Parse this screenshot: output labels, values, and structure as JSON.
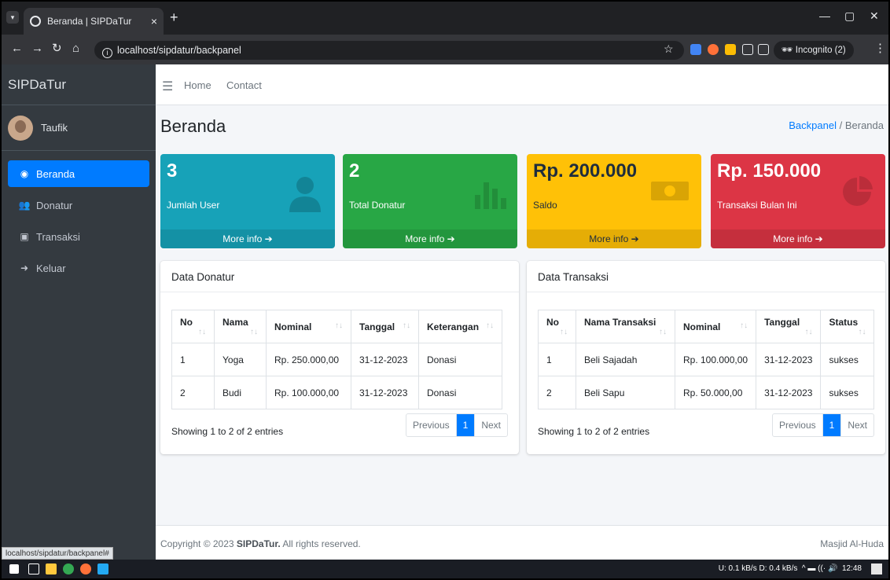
{
  "browser": {
    "tab_title": "Beranda | SIPDaTur",
    "tab_close": "×",
    "new_tab": "+",
    "url": "localhost/sipdatur/backpanel",
    "incognito": "Incognito (2)",
    "status_url": "localhost/sipdatur/backpanel#"
  },
  "sidebar": {
    "brand": "SIPDaTur",
    "user_name": "Taufik",
    "items": [
      {
        "label": "Beranda",
        "icon": "dashboard-icon"
      },
      {
        "label": "Donatur",
        "icon": "users-icon"
      },
      {
        "label": "Transaksi",
        "icon": "money-icon"
      },
      {
        "label": "Keluar",
        "icon": "sign-out-icon"
      }
    ]
  },
  "topnav": {
    "home": "Home",
    "contact": "Contact"
  },
  "page": {
    "title": "Beranda",
    "breadcrumb_link": "Backpanel",
    "breadcrumb_sep": "/",
    "breadcrumb_current": "Beranda"
  },
  "stats": [
    {
      "value": "3",
      "label": "Jumlah User",
      "more": "More info ➔",
      "color": "#17a2b8"
    },
    {
      "value": "2",
      "label": "Total Donatur",
      "more": "More info ➔",
      "color": "#28a745"
    },
    {
      "value": "Rp. 200.000",
      "label": "Saldo",
      "more": "More info ➔",
      "color": "#ffc107"
    },
    {
      "value": "Rp. 150.000",
      "label": "Transaksi Bulan Ini",
      "more": "More info ➔",
      "color": "#dc3545"
    }
  ],
  "donatur_table": {
    "title": "Data Donatur",
    "headers": [
      "No",
      "Nama",
      "Nominal",
      "Tanggal",
      "Keterangan"
    ],
    "rows": [
      [
        "1",
        "Yoga",
        "Rp. 250.000,00",
        "31-12-2023",
        "Donasi"
      ],
      [
        "2",
        "Budi",
        "Rp. 100.000,00",
        "31-12-2023",
        "Donasi"
      ]
    ],
    "showing": "Showing 1 to 2 of 2 entries",
    "previous": "Previous",
    "page": "1",
    "next": "Next"
  },
  "transaksi_table": {
    "title": "Data Transaksi",
    "headers": [
      "No",
      "Nama Transaksi",
      "Nominal",
      "Tanggal",
      "Status"
    ],
    "rows": [
      [
        "1",
        "Beli Sajadah",
        "Rp. 100.000,00",
        "31-12-2023",
        "sukses"
      ],
      [
        "2",
        "Beli Sapu",
        "Rp. 50.000,00",
        "31-12-2023",
        "sukses"
      ]
    ],
    "showing": "Showing 1 to 2 of 2 entries",
    "previous": "Previous",
    "page": "1",
    "next": "Next"
  },
  "footer": {
    "copy_prefix": "Copyright © 2023 ",
    "copy_brand": "SIPDaTur.",
    "copy_suffix": " All rights reserved.",
    "right": "Masjid Al-Huda"
  },
  "taskbar": {
    "time": "12:48",
    "net_up": "U: 0.1 kB/s",
    "net_down": "D: 0.4 kB/s"
  }
}
